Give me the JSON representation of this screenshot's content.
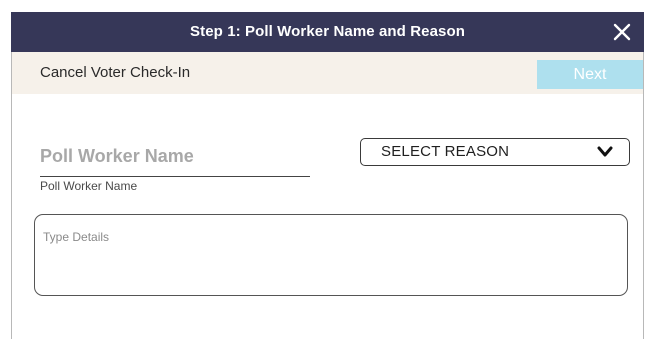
{
  "dialog": {
    "title": "Step 1: Poll Worker Name and Reason",
    "close_icon": "close-icon"
  },
  "subbar": {
    "cancel_label": "Cancel Voter Check-In",
    "next_label": "Next"
  },
  "form": {
    "poll_worker_name": {
      "placeholder": "Poll Worker Name",
      "value": "",
      "label": "Poll Worker Name"
    },
    "reason_select": {
      "selected": "SELECT REASON",
      "icon": "chevron-down-icon"
    },
    "details": {
      "placeholder": "Type Details",
      "value": ""
    }
  },
  "colors": {
    "titlebar_bg": "#363758",
    "subbar_bg": "#f6f1ea",
    "next_button_bg": "#aee0ee",
    "next_button_text": "#ffffff"
  }
}
